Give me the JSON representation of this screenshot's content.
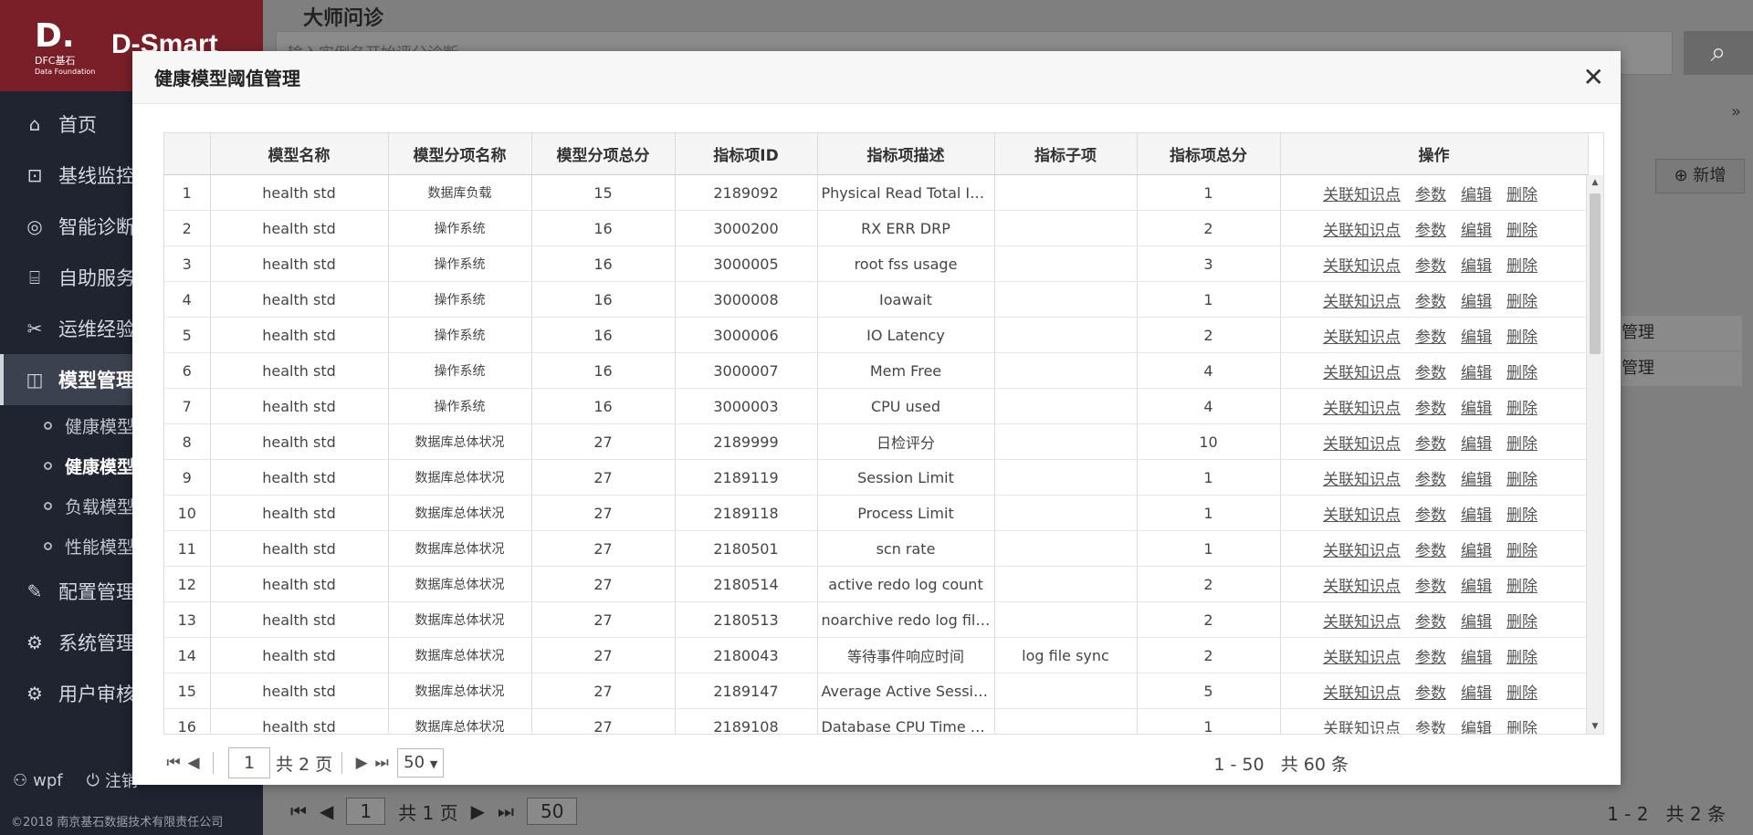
{
  "app": {
    "brand": "D-Smart",
    "logo_text": "DFC基石",
    "logo_sub": "Data Foundation"
  },
  "sidebar": {
    "items": [
      {
        "label": "首页",
        "icon": "home-icon"
      },
      {
        "label": "基线监控",
        "icon": "monitor-icon"
      },
      {
        "label": "智能诊断",
        "icon": "diagnose-icon"
      },
      {
        "label": "自助服务",
        "icon": "robot-icon"
      },
      {
        "label": "运维经验",
        "icon": "tools-icon"
      },
      {
        "label": "模型管理",
        "icon": "chart-icon"
      },
      {
        "label": "配置管理",
        "icon": "config-icon"
      },
      {
        "label": "系统管理",
        "icon": "gear-icon"
      },
      {
        "label": "用户审核",
        "icon": "user-check-icon"
      }
    ],
    "sub_items": [
      "健康模型",
      "健康模型",
      "负载模型",
      "性能模型"
    ],
    "user": "wpf",
    "logout": "注销",
    "copyright": "©2018 南京基石数据技术有限责任公司"
  },
  "main": {
    "title": "大师问诊",
    "search_placeholder": "输入实例名开始评分诊断",
    "add_label": "新增",
    "bg_rows": [
      "管理",
      "管理"
    ],
    "bg_pager": {
      "page": "1",
      "total": "共 1 页",
      "size": "50",
      "range": "1 - 2",
      "count": "共 2 条"
    }
  },
  "modal": {
    "title": "健康模型阈值管理",
    "columns": [
      "",
      "模型名称",
      "模型分项名称",
      "模型分项总分",
      "指标项ID",
      "指标项描述",
      "指标子项",
      "指标项总分",
      "操作"
    ],
    "ops": [
      "关联知识点",
      "参数",
      "编辑",
      "删除"
    ],
    "rows": [
      [
        "1",
        "health std",
        "数据库负载",
        "15",
        "2189092",
        "Physical Read Total IO R...",
        "",
        "1"
      ],
      [
        "2",
        "health std",
        "操作系统",
        "16",
        "3000200",
        "RX ERR DRP",
        "",
        "2"
      ],
      [
        "3",
        "health std",
        "操作系统",
        "16",
        "3000005",
        "root fss usage",
        "",
        "3"
      ],
      [
        "4",
        "health std",
        "操作系统",
        "16",
        "3000008",
        "Ioawait",
        "",
        "1"
      ],
      [
        "5",
        "health std",
        "操作系统",
        "16",
        "3000006",
        "IO Latency",
        "",
        "2"
      ],
      [
        "6",
        "health std",
        "操作系统",
        "16",
        "3000007",
        "Mem Free",
        "",
        "4"
      ],
      [
        "7",
        "health std",
        "操作系统",
        "16",
        "3000003",
        "CPU used",
        "",
        "4"
      ],
      [
        "8",
        "health std",
        "数据库总体状况",
        "27",
        "2189999",
        "日检评分",
        "",
        "10"
      ],
      [
        "9",
        "health std",
        "数据库总体状况",
        "27",
        "2189119",
        "Session Limit",
        "",
        "1"
      ],
      [
        "10",
        "health std",
        "数据库总体状况",
        "27",
        "2189118",
        "Process Limit",
        "",
        "1"
      ],
      [
        "11",
        "health std",
        "数据库总体状况",
        "27",
        "2180501",
        "scn rate",
        "",
        "1"
      ],
      [
        "12",
        "health std",
        "数据库总体状况",
        "27",
        "2180514",
        "active redo log count",
        "",
        "2"
      ],
      [
        "13",
        "health std",
        "数据库总体状况",
        "27",
        "2180513",
        "noarchive redo log file c...",
        "",
        "2"
      ],
      [
        "14",
        "health std",
        "数据库总体状况",
        "27",
        "2180043",
        "等待事件响应时间",
        "log file sync",
        "2"
      ],
      [
        "15",
        "health std",
        "数据库总体状况",
        "27",
        "2189147",
        "Average Active Sessions",
        "",
        "5"
      ],
      [
        "16",
        "health std",
        "数据库总体状况",
        "27",
        "2189108",
        "Database CPU Time Ratio",
        "",
        "1"
      ]
    ],
    "pager": {
      "page": "1",
      "total": "共 2 页",
      "size": "50",
      "range": "1 - 50",
      "count": "共 60 条"
    }
  }
}
